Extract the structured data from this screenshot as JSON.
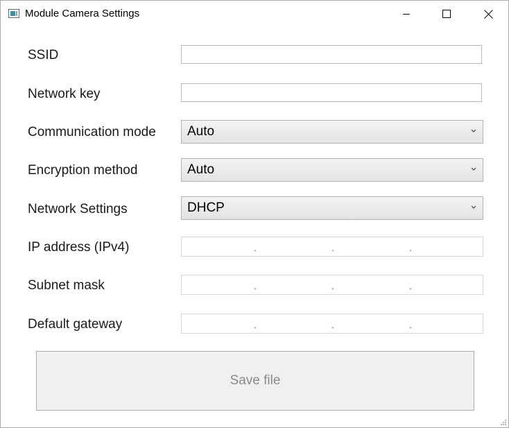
{
  "window": {
    "title": "Module Camera Settings"
  },
  "form": {
    "ssid_label": "SSID",
    "ssid_value": "",
    "network_key_label": "Network key",
    "network_key_value": "",
    "communication_mode_label": "Communication mode",
    "communication_mode_value": "Auto",
    "encryption_method_label": "Encryption method",
    "encryption_method_value": "Auto",
    "network_settings_label": "Network Settings",
    "network_settings_value": "DHCP",
    "ip_address_label": "IP address (IPv4)",
    "subnet_mask_label": "Subnet mask",
    "default_gateway_label": "Default gateway",
    "ip_separator": "."
  },
  "actions": {
    "save_label": "Save file"
  },
  "icons": {
    "app": "app-window-icon",
    "minimize": "minimize-icon",
    "maximize": "maximize-icon",
    "close": "close-icon",
    "dropdown": "chevron-down-icon",
    "resize": "resize-grip-icon"
  },
  "colors": {
    "window_bg": "#ffffff",
    "combo_bg": "#e8e8e8",
    "button_bg": "#f0f0f0",
    "disabled_text": "#8a8a8a",
    "border": "#b9b9b9"
  }
}
